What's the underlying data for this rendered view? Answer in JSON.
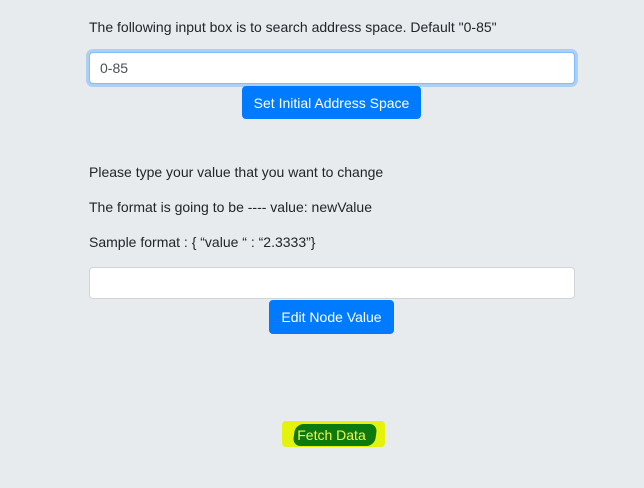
{
  "address_section": {
    "instruction": "The following input box is to search address space. Default \"0-85\"",
    "input_value": "0-85",
    "button_label": "Set Initial Address Space"
  },
  "edit_section": {
    "line1": "Please type your value that you want to change",
    "line2": "The format is going to be ---- value: newValue",
    "line3": "Sample format : { “value “ : “2.3333”}",
    "input_value": "",
    "button_label": "Edit Node Value"
  },
  "fetch": {
    "button_label": "Fetch Data"
  },
  "colors": {
    "background": "#e7ebee",
    "primary": "#007bff",
    "highlight_yellow": "#e5f20c",
    "highlight_green": "#0d7a10"
  }
}
